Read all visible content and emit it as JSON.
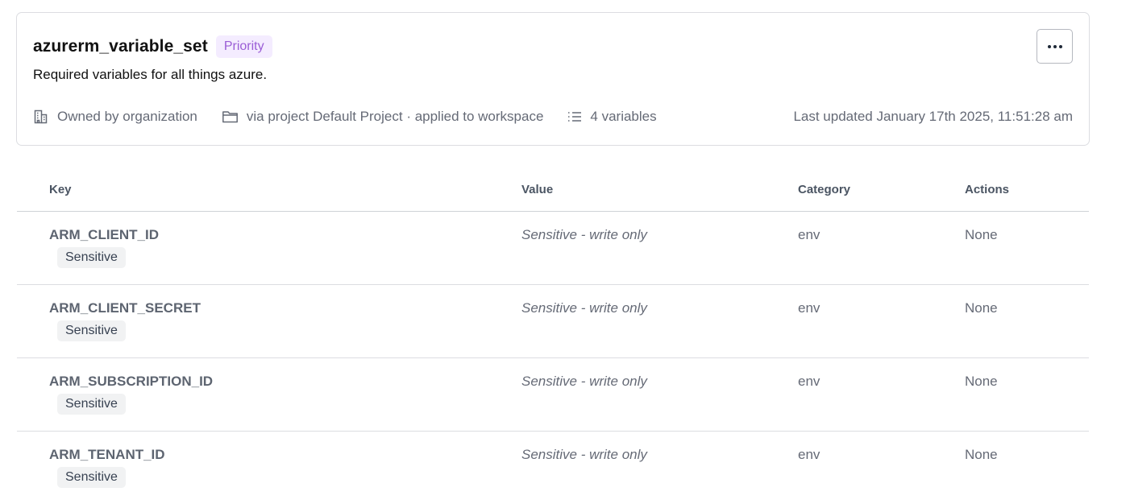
{
  "variable_set": {
    "name": "azurerm_variable_set",
    "badge": "Priority",
    "description": "Required variables for all things azure.",
    "more_button_label": "···",
    "meta": {
      "owner": "Owned by organization",
      "scope": "via project Default Project · applied to workspace",
      "count": "4 variables",
      "updated": "Last updated January 17th 2025, 11:51:28 am"
    }
  },
  "table": {
    "headers": {
      "key": "Key",
      "value": "Value",
      "category": "Category",
      "actions": "Actions"
    },
    "rows": [
      {
        "key": "ARM_CLIENT_ID",
        "badge": "Sensitive",
        "value": "Sensitive - write only",
        "category": "env",
        "actions": "None"
      },
      {
        "key": "ARM_CLIENT_SECRET",
        "badge": "Sensitive",
        "value": "Sensitive - write only",
        "category": "env",
        "actions": "None"
      },
      {
        "key": "ARM_SUBSCRIPTION_ID",
        "badge": "Sensitive",
        "value": "Sensitive - write only",
        "category": "env",
        "actions": "None"
      },
      {
        "key": "ARM_TENANT_ID",
        "badge": "Sensitive",
        "value": "Sensitive - write only",
        "category": "env",
        "actions": "None"
      }
    ]
  },
  "colors": {
    "priority_badge_bg": "#f4ecff",
    "priority_badge_text": "#9b5ed6",
    "muted_text": "#656a76"
  },
  "icons": {
    "owner": "building-icon",
    "scope": "folder-icon",
    "count": "list-icon",
    "more": "ellipsis-icon"
  }
}
